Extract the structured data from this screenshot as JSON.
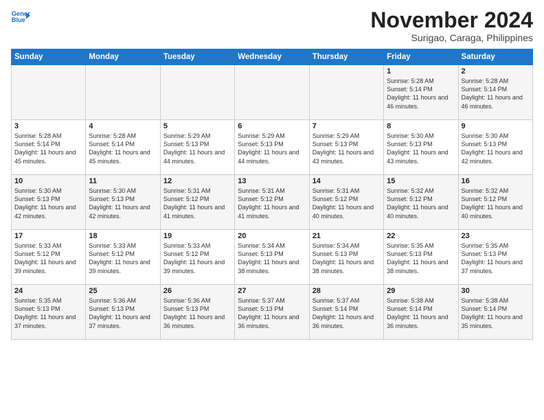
{
  "header": {
    "logo_line1": "General",
    "logo_line2": "Blue",
    "month_title": "November 2024",
    "subtitle": "Surigao, Caraga, Philippines"
  },
  "weekdays": [
    "Sunday",
    "Monday",
    "Tuesday",
    "Wednesday",
    "Thursday",
    "Friday",
    "Saturday"
  ],
  "weeks": [
    [
      {
        "day": "",
        "sunrise": "",
        "sunset": "",
        "daylight": ""
      },
      {
        "day": "",
        "sunrise": "",
        "sunset": "",
        "daylight": ""
      },
      {
        "day": "",
        "sunrise": "",
        "sunset": "",
        "daylight": ""
      },
      {
        "day": "",
        "sunrise": "",
        "sunset": "",
        "daylight": ""
      },
      {
        "day": "",
        "sunrise": "",
        "sunset": "",
        "daylight": ""
      },
      {
        "day": "1",
        "sunrise": "Sunrise: 5:28 AM",
        "sunset": "Sunset: 5:14 PM",
        "daylight": "Daylight: 11 hours and 46 minutes."
      },
      {
        "day": "2",
        "sunrise": "Sunrise: 5:28 AM",
        "sunset": "Sunset: 5:14 PM",
        "daylight": "Daylight: 11 hours and 46 minutes."
      }
    ],
    [
      {
        "day": "3",
        "sunrise": "Sunrise: 5:28 AM",
        "sunset": "Sunset: 5:14 PM",
        "daylight": "Daylight: 11 hours and 45 minutes."
      },
      {
        "day": "4",
        "sunrise": "Sunrise: 5:28 AM",
        "sunset": "Sunset: 5:14 PM",
        "daylight": "Daylight: 11 hours and 45 minutes."
      },
      {
        "day": "5",
        "sunrise": "Sunrise: 5:29 AM",
        "sunset": "Sunset: 5:13 PM",
        "daylight": "Daylight: 11 hours and 44 minutes."
      },
      {
        "day": "6",
        "sunrise": "Sunrise: 5:29 AM",
        "sunset": "Sunset: 5:13 PM",
        "daylight": "Daylight: 11 hours and 44 minutes."
      },
      {
        "day": "7",
        "sunrise": "Sunrise: 5:29 AM",
        "sunset": "Sunset: 5:13 PM",
        "daylight": "Daylight: 11 hours and 43 minutes."
      },
      {
        "day": "8",
        "sunrise": "Sunrise: 5:30 AM",
        "sunset": "Sunset: 5:13 PM",
        "daylight": "Daylight: 11 hours and 43 minutes."
      },
      {
        "day": "9",
        "sunrise": "Sunrise: 5:30 AM",
        "sunset": "Sunset: 5:13 PM",
        "daylight": "Daylight: 11 hours and 42 minutes."
      }
    ],
    [
      {
        "day": "10",
        "sunrise": "Sunrise: 5:30 AM",
        "sunset": "Sunset: 5:13 PM",
        "daylight": "Daylight: 11 hours and 42 minutes."
      },
      {
        "day": "11",
        "sunrise": "Sunrise: 5:30 AM",
        "sunset": "Sunset: 5:13 PM",
        "daylight": "Daylight: 11 hours and 42 minutes."
      },
      {
        "day": "12",
        "sunrise": "Sunrise: 5:31 AM",
        "sunset": "Sunset: 5:12 PM",
        "daylight": "Daylight: 11 hours and 41 minutes."
      },
      {
        "day": "13",
        "sunrise": "Sunrise: 5:31 AM",
        "sunset": "Sunset: 5:12 PM",
        "daylight": "Daylight: 11 hours and 41 minutes."
      },
      {
        "day": "14",
        "sunrise": "Sunrise: 5:31 AM",
        "sunset": "Sunset: 5:12 PM",
        "daylight": "Daylight: 11 hours and 40 minutes."
      },
      {
        "day": "15",
        "sunrise": "Sunrise: 5:32 AM",
        "sunset": "Sunset: 5:12 PM",
        "daylight": "Daylight: 11 hours and 40 minutes."
      },
      {
        "day": "16",
        "sunrise": "Sunrise: 5:32 AM",
        "sunset": "Sunset: 5:12 PM",
        "daylight": "Daylight: 11 hours and 40 minutes."
      }
    ],
    [
      {
        "day": "17",
        "sunrise": "Sunrise: 5:33 AM",
        "sunset": "Sunset: 5:12 PM",
        "daylight": "Daylight: 11 hours and 39 minutes."
      },
      {
        "day": "18",
        "sunrise": "Sunrise: 5:33 AM",
        "sunset": "Sunset: 5:12 PM",
        "daylight": "Daylight: 11 hours and 39 minutes."
      },
      {
        "day": "19",
        "sunrise": "Sunrise: 5:33 AM",
        "sunset": "Sunset: 5:12 PM",
        "daylight": "Daylight: 11 hours and 39 minutes."
      },
      {
        "day": "20",
        "sunrise": "Sunrise: 5:34 AM",
        "sunset": "Sunset: 5:13 PM",
        "daylight": "Daylight: 11 hours and 38 minutes."
      },
      {
        "day": "21",
        "sunrise": "Sunrise: 5:34 AM",
        "sunset": "Sunset: 5:13 PM",
        "daylight": "Daylight: 11 hours and 38 minutes."
      },
      {
        "day": "22",
        "sunrise": "Sunrise: 5:35 AM",
        "sunset": "Sunset: 5:13 PM",
        "daylight": "Daylight: 11 hours and 38 minutes."
      },
      {
        "day": "23",
        "sunrise": "Sunrise: 5:35 AM",
        "sunset": "Sunset: 5:13 PM",
        "daylight": "Daylight: 11 hours and 37 minutes."
      }
    ],
    [
      {
        "day": "24",
        "sunrise": "Sunrise: 5:35 AM",
        "sunset": "Sunset: 5:13 PM",
        "daylight": "Daylight: 11 hours and 37 minutes."
      },
      {
        "day": "25",
        "sunrise": "Sunrise: 5:36 AM",
        "sunset": "Sunset: 5:13 PM",
        "daylight": "Daylight: 11 hours and 37 minutes."
      },
      {
        "day": "26",
        "sunrise": "Sunrise: 5:36 AM",
        "sunset": "Sunset: 5:13 PM",
        "daylight": "Daylight: 11 hours and 36 minutes."
      },
      {
        "day": "27",
        "sunrise": "Sunrise: 5:37 AM",
        "sunset": "Sunset: 5:13 PM",
        "daylight": "Daylight: 11 hours and 36 minutes."
      },
      {
        "day": "28",
        "sunrise": "Sunrise: 5:37 AM",
        "sunset": "Sunset: 5:14 PM",
        "daylight": "Daylight: 11 hours and 36 minutes."
      },
      {
        "day": "29",
        "sunrise": "Sunrise: 5:38 AM",
        "sunset": "Sunset: 5:14 PM",
        "daylight": "Daylight: 11 hours and 36 minutes."
      },
      {
        "day": "30",
        "sunrise": "Sunrise: 5:38 AM",
        "sunset": "Sunset: 5:14 PM",
        "daylight": "Daylight: 11 hours and 35 minutes."
      }
    ]
  ]
}
